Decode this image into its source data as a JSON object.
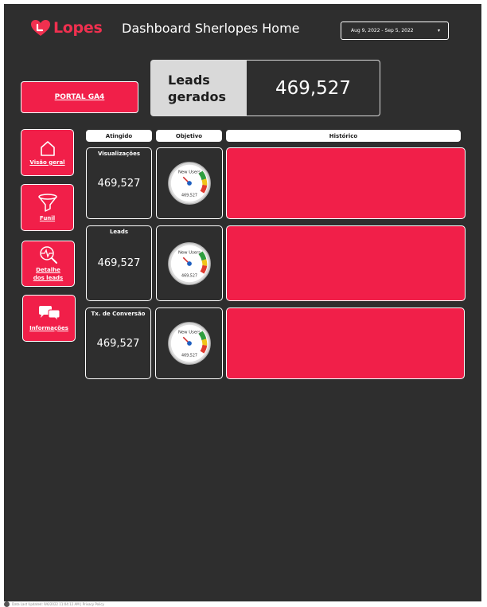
{
  "header": {
    "logo_text": "Lopes",
    "title": "Dashboard Sherlopes Home",
    "date_range": "Aug 9, 2022 - Sep 5, 2022"
  },
  "portal_button": "PORTAL GA4",
  "kpi": {
    "label": "Leads gerados",
    "value": "469,527"
  },
  "nav": [
    {
      "label": "Visão geral",
      "icon": "home-icon"
    },
    {
      "label": "Funil",
      "icon": "funnel-icon"
    },
    {
      "label": "Detalhe dos leads",
      "icon": "magnify-pulse-icon"
    },
    {
      "label": "Informações",
      "icon": "chat-bubbles-icon"
    }
  ],
  "columns": {
    "atingido": "Atingido",
    "objetivo": "Objetivo",
    "historico": "Histórico"
  },
  "metrics": [
    {
      "title": "Visualizações",
      "value": "469,527",
      "gauge_label": "New Users",
      "gauge_value": "469,527"
    },
    {
      "title": "Leads",
      "value": "469,527",
      "gauge_label": "New Users",
      "gauge_value": "469,527"
    },
    {
      "title": "Tx. de Conversão",
      "value": "469,527",
      "gauge_label": "New Users",
      "gauge_value": "469,527"
    }
  ],
  "footer": {
    "text": "Data Last Updated: 9/6/2022 11:04:12 AM | Privacy Policy"
  },
  "colors": {
    "accent": "#f11f49",
    "background": "#2e2e2e",
    "logo": "#f0304f"
  }
}
